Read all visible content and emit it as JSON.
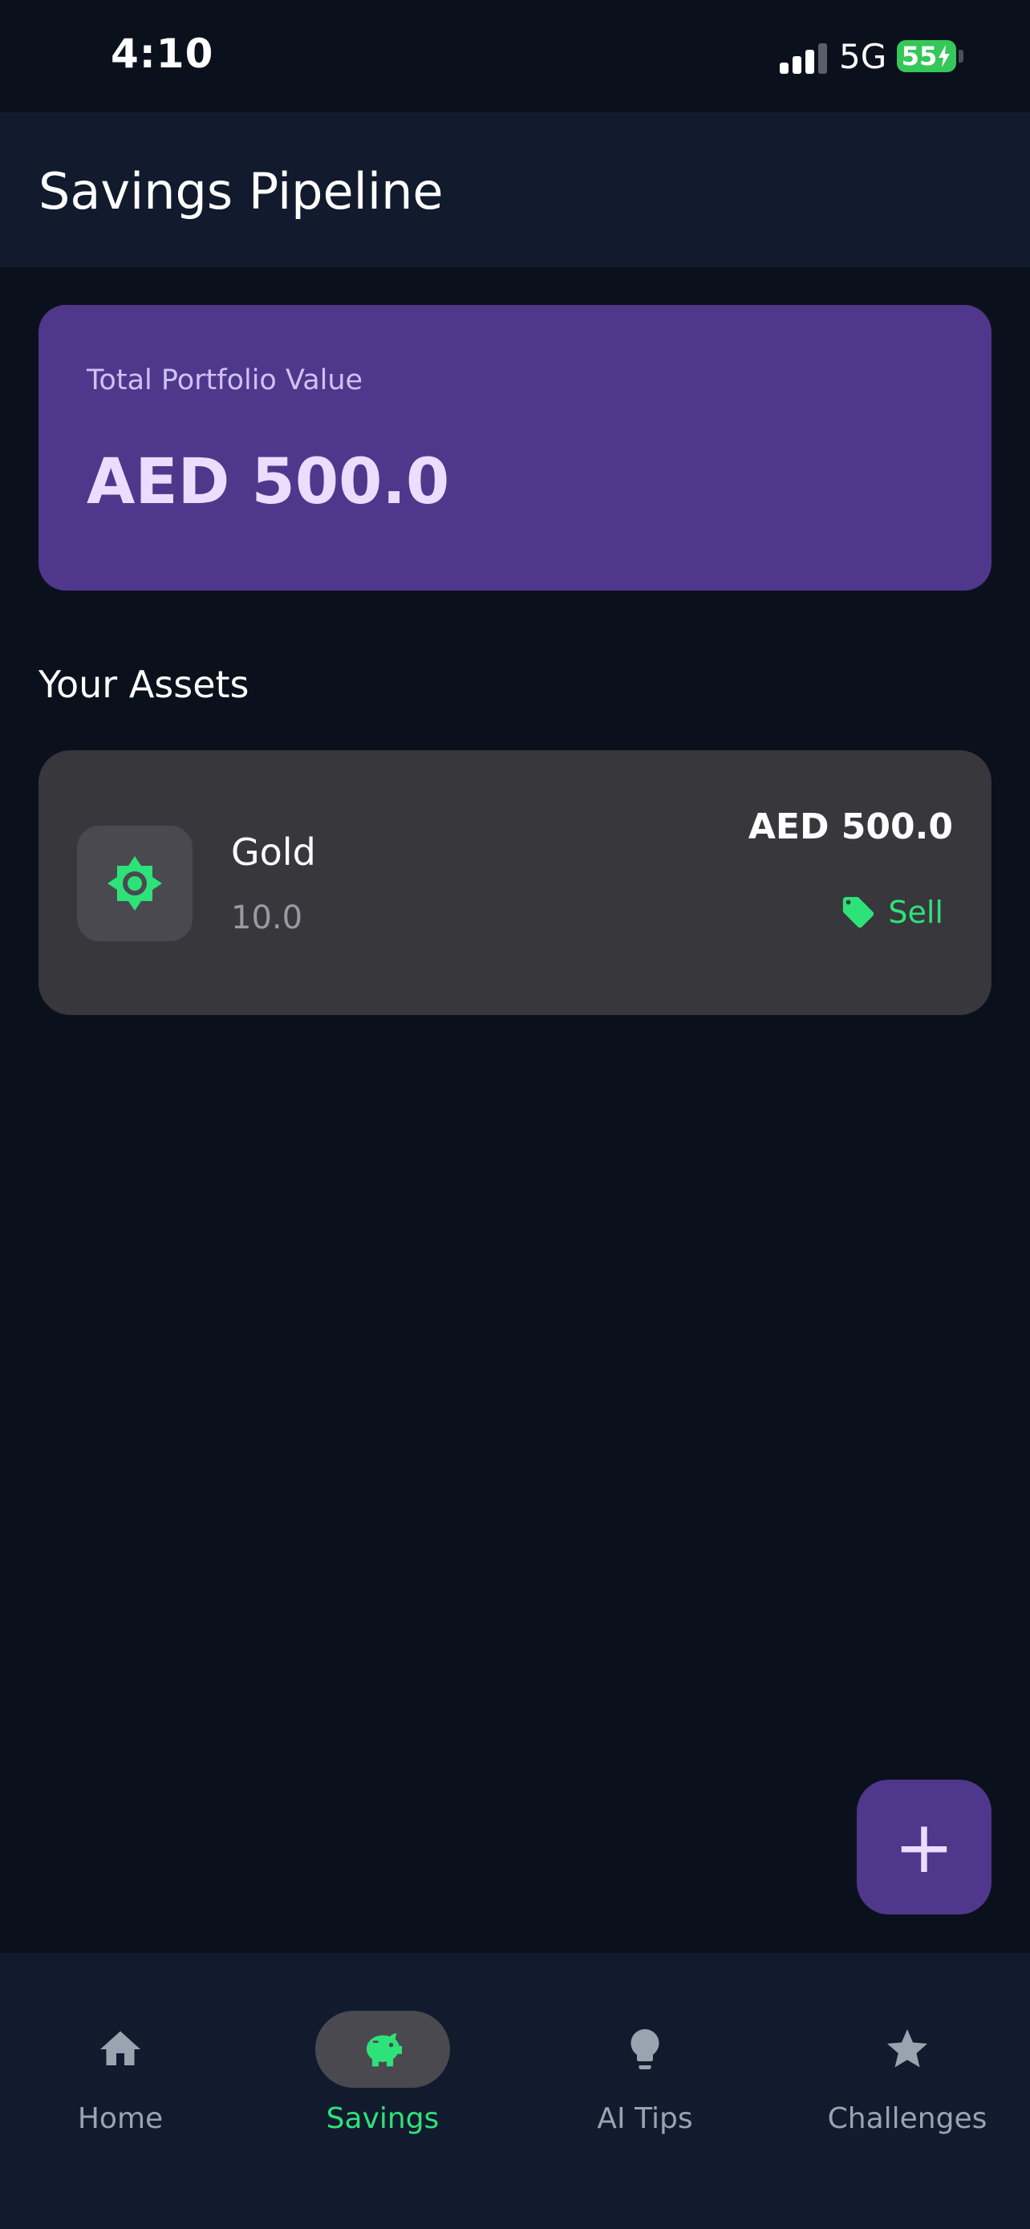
{
  "status_bar": {
    "time": "4:10",
    "network": "5G",
    "battery": "55"
  },
  "header": {
    "title": "Savings Pipeline"
  },
  "portfolio": {
    "label": "Total Portfolio Value",
    "value": "AED 500.0"
  },
  "assets_section": {
    "title": "Your Assets"
  },
  "assets": [
    {
      "name": "Gold",
      "quantity": "10.0",
      "value": "AED 500.0",
      "action_label": "Sell",
      "icon": "sun-gear-icon"
    }
  ],
  "fab": {
    "label": "+"
  },
  "bottom_nav": {
    "items": [
      {
        "label": "Home",
        "icon": "home-icon",
        "active": false
      },
      {
        "label": "Savings",
        "icon": "piggy-bank-icon",
        "active": true
      },
      {
        "label": "AI Tips",
        "icon": "lightbulb-icon",
        "active": false
      },
      {
        "label": "Challenges",
        "icon": "star-icon",
        "active": false
      }
    ]
  },
  "colors": {
    "background": "#0b111c",
    "surface": "#111b2d",
    "card_purple": "#4f378b",
    "asset_card": "#38373c",
    "accent_green": "#2ee27a"
  }
}
